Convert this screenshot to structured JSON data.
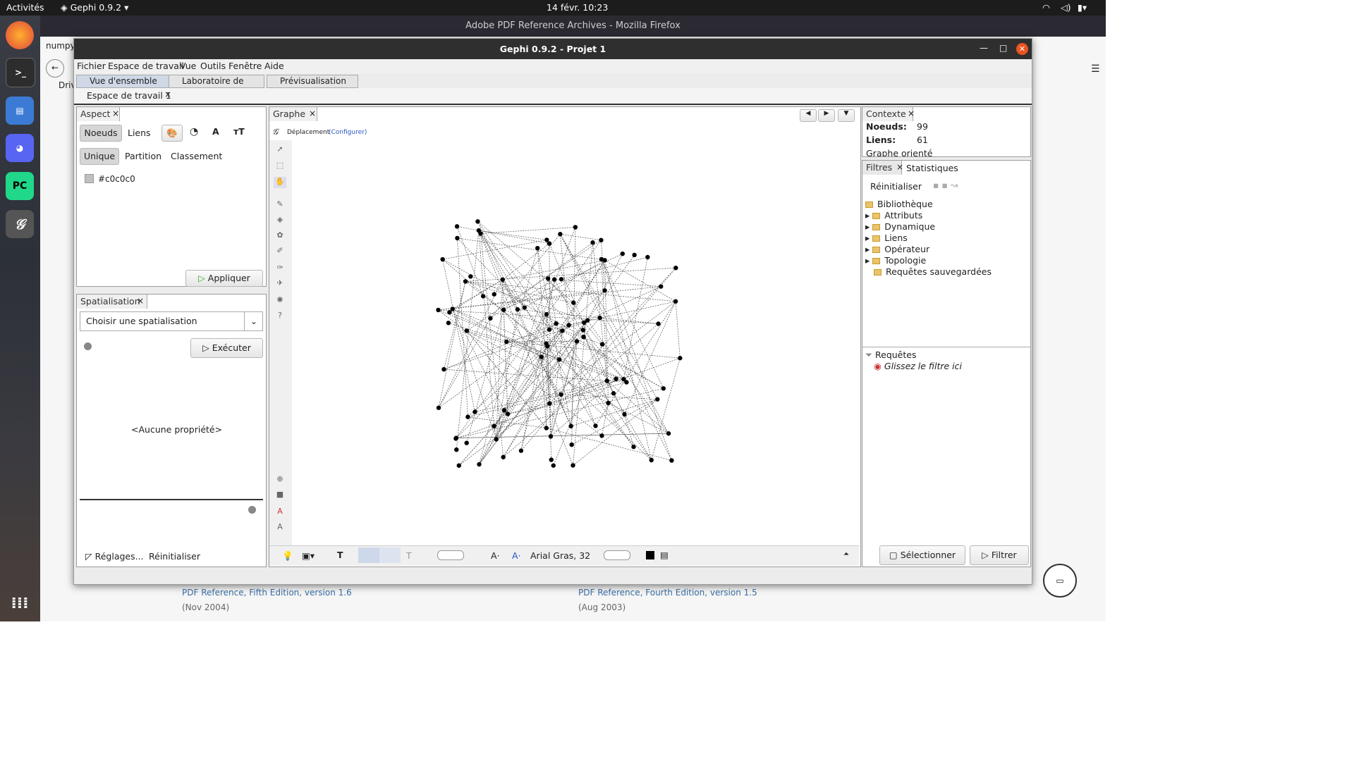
{
  "topbar": {
    "activities": "Activités",
    "app": "Gephi 0.9.2",
    "datetime": "14 févr.  10:23"
  },
  "firefox": {
    "title": "Adobe PDF Reference Archives - Mozilla Firefox",
    "tab_partial": "numpy.",
    "bookmark_partial": "Driv",
    "links": [
      {
        "text": "PDF Reference, Fifth Edition, version 1.6",
        "date": "(Nov 2004)"
      },
      {
        "text": "PDF Reference, Fourth Edition, version 1.5",
        "date": "(Aug 2003)"
      }
    ]
  },
  "gephi": {
    "title": "Gephi 0.9.2 - Projet 1",
    "menu": [
      "Fichier",
      "Espace de travail",
      "Vue",
      "Outils",
      "Fenêtre",
      "Aide"
    ],
    "views": [
      "Vue d'ensemble",
      "Laboratoire de données",
      "Prévisualisation"
    ],
    "workspace_tab": "Espace de travail 1",
    "aspect": {
      "tab": "Aspect",
      "subtabs": [
        "Noeuds",
        "Liens"
      ],
      "modes": [
        "Unique",
        "Partition",
        "Classement"
      ],
      "color": "#c0c0c0",
      "apply": "Appliquer"
    },
    "spatial": {
      "tab": "Spatialisation",
      "select": "Choisir une spatialisation",
      "run": "Exécuter",
      "noprop": "<Aucune propriété>",
      "settings": "Réglages...",
      "reset": "Réinitialiser"
    },
    "graph": {
      "tab": "Graphe",
      "tool": "Déplacement",
      "configure": "(Configurer)",
      "font": "Arial Gras, 32"
    },
    "context": {
      "tab": "Contexte",
      "nodes_label": "Noeuds:",
      "nodes": "99",
      "edges_label": "Liens:",
      "edges": "61",
      "type": "Graphe orienté"
    },
    "filters": {
      "tab": "Filtres",
      "stats_tab": "Statistiques",
      "reset": "Réinitialiser",
      "library": "Bibliothèque",
      "items": [
        "Attributs",
        "Dynamique",
        "Liens",
        "Opérateur",
        "Topologie",
        "Requêtes sauvegardées"
      ],
      "queries": "Requêtes",
      "drop": "Glissez le filtre ici",
      "select": "Sélectionner",
      "filter": "Filtrer"
    }
  }
}
